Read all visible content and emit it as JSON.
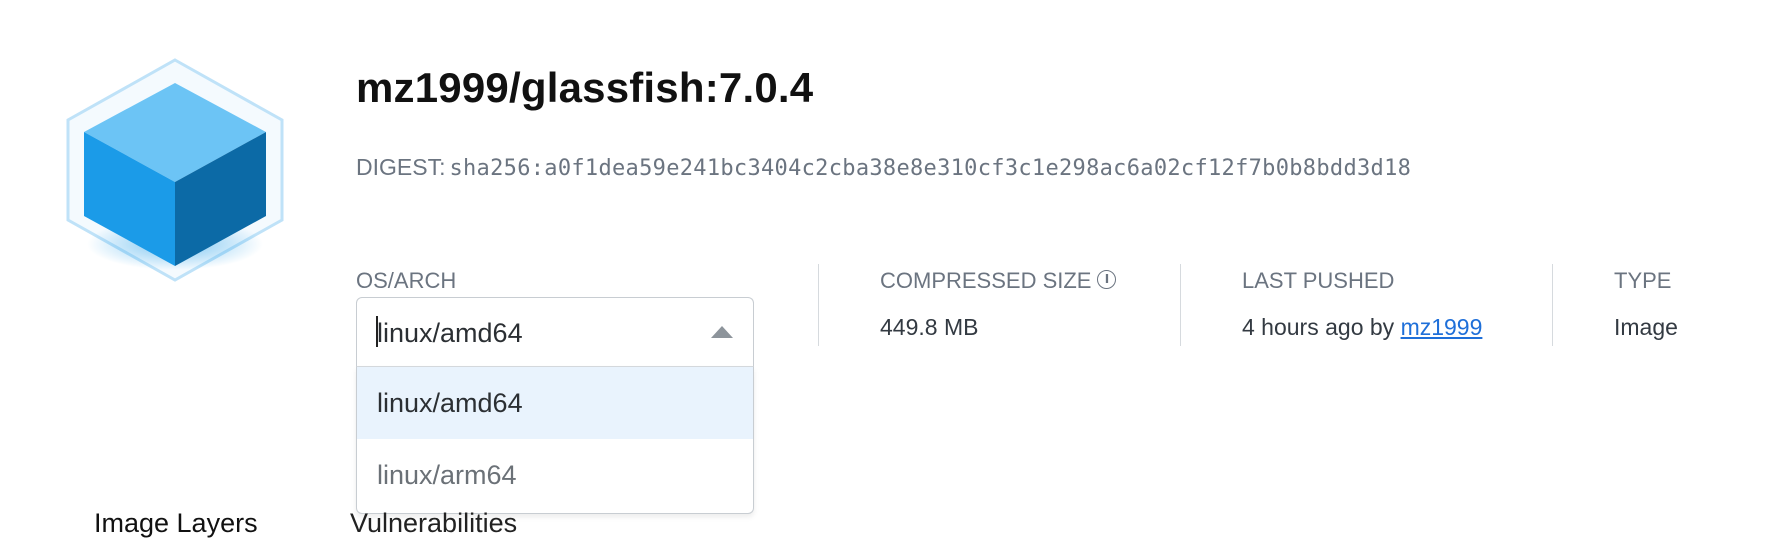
{
  "image": {
    "name": "mz1999/glassfish:7.0.4",
    "digest_label": "DIGEST:",
    "digest_value": "sha256:a0f1dea59e241bc3404c2cba38e8e310cf3c1e298ac6a02cf12f7b0b8bdd3d18"
  },
  "logo_icon": "cube-icon",
  "os_arch": {
    "label": "OS/ARCH",
    "selected": "linux/amd64",
    "options": [
      "linux/amd64",
      "linux/arm64"
    ]
  },
  "compressed_size": {
    "label": "COMPRESSED SIZE",
    "info_icon": "info-icon",
    "value": "449.8 MB"
  },
  "last_pushed": {
    "label": "LAST PUSHED",
    "text": "4 hours ago by",
    "user": "mz1999"
  },
  "type": {
    "label": "TYPE",
    "value": "Image"
  },
  "tabs": [
    {
      "label": "Image Layers"
    },
    {
      "label": "Vulnerabilities"
    }
  ],
  "colors": {
    "accent_link": "#1e6fd9",
    "selected_option_bg": "#e9f3fd",
    "cube_front": "#1b9be8",
    "cube_top": "#6cc4f5",
    "cube_side": "#0c6aa6"
  }
}
